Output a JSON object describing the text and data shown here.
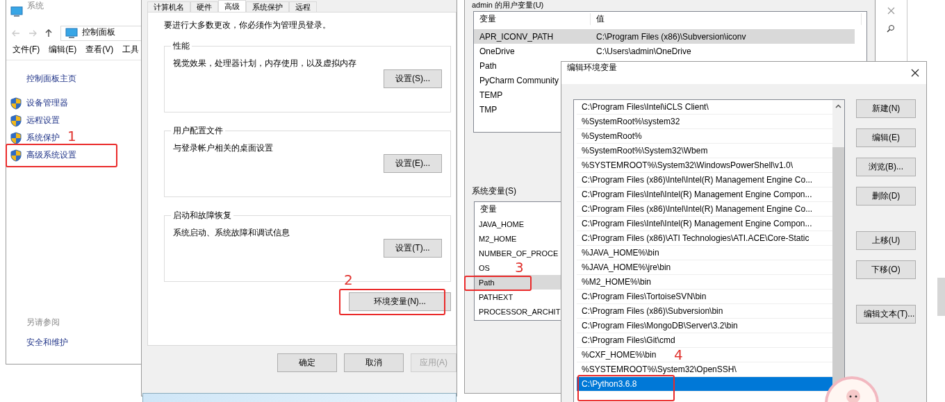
{
  "system_window": {
    "title": "系统",
    "breadcrumb": "控制面板",
    "menu": [
      "文件(F)",
      "编辑(E)",
      "查看(V)",
      "工具"
    ],
    "home_link": "控制面板主页",
    "tasks": [
      "设备管理器",
      "远程设置",
      "系统保护",
      "高级系统设置"
    ],
    "see_also_heading": "另请参阅",
    "see_also": [
      "安全和维护"
    ]
  },
  "properties_dialog": {
    "tabs": [
      {
        "label": "计算机名",
        "selected": false
      },
      {
        "label": "硬件",
        "selected": false
      },
      {
        "label": "高级",
        "selected": true
      },
      {
        "label": "系统保护",
        "selected": false
      },
      {
        "label": "远程",
        "selected": false
      }
    ],
    "notice": "要进行大多数更改，你必须作为管理员登录。",
    "groups": [
      {
        "title": "性能",
        "description": "视觉效果，处理器计划，内存使用，以及虚拟内存",
        "button": "设置(S)..."
      },
      {
        "title": "用户配置文件",
        "description": "与登录帐户相关的桌面设置",
        "button": "设置(E)..."
      },
      {
        "title": "启动和故障恢复",
        "description": "系统启动、系统故障和调试信息",
        "button": "设置(T)..."
      }
    ],
    "env_button": "环境变量(N)...",
    "footer_buttons": [
      {
        "label": "确定",
        "disabled": false
      },
      {
        "label": "取消",
        "disabled": false
      },
      {
        "label": "应用(A)",
        "disabled": true
      }
    ]
  },
  "env_dialog": {
    "user_group": "admin 的用户变量(U)",
    "user_columns": [
      "变量",
      "值"
    ],
    "user_rows": [
      {
        "name": "APR_ICONV_PATH",
        "value": "C:\\Program Files (x86)\\Subversion\\iconv",
        "selected": true
      },
      {
        "name": "OneDrive",
        "value": "C:\\Users\\admin\\OneDrive",
        "selected": false
      },
      {
        "name": "Path",
        "selected": false
      },
      {
        "name": "PyCharm Community",
        "selected": false
      },
      {
        "name": "TEMP",
        "selected": false
      },
      {
        "name": "TMP",
        "selected": false
      }
    ],
    "system_group": "系统变量(S)",
    "system_columns": [
      "变量"
    ],
    "system_rows": [
      {
        "name": "JAVA_HOME",
        "selected": false
      },
      {
        "name": "M2_HOME",
        "selected": false
      },
      {
        "name": "NUMBER_OF_PROCE",
        "selected": false
      },
      {
        "name": "OS",
        "selected": false
      },
      {
        "name": "Path",
        "selected": true
      },
      {
        "name": "PATHEXT",
        "selected": false
      },
      {
        "name": "PROCESSOR_ARCHIT",
        "selected": false
      }
    ]
  },
  "edit_dialog": {
    "title": "编辑环境变量",
    "entries": [
      {
        "text": "C:\\Program Files\\Intel\\iCLS Client\\",
        "selected": false
      },
      {
        "text": "%SystemRoot%\\system32",
        "selected": false
      },
      {
        "text": "%SystemRoot%",
        "selected": false
      },
      {
        "text": "%SystemRoot%\\System32\\Wbem",
        "selected": false
      },
      {
        "text": "%SYSTEMROOT%\\System32\\WindowsPowerShell\\v1.0\\",
        "selected": false
      },
      {
        "text": "C:\\Program Files (x86)\\Intel\\Intel(R) Management Engine Co...",
        "selected": false
      },
      {
        "text": "C:\\Program Files\\Intel\\Intel(R) Management Engine Compon...",
        "selected": false
      },
      {
        "text": "C:\\Program Files (x86)\\Intel\\Intel(R) Management Engine Co...",
        "selected": false
      },
      {
        "text": "C:\\Program Files\\Intel\\Intel(R) Management Engine Compon...",
        "selected": false
      },
      {
        "text": "C:\\Program Files (x86)\\ATI Technologies\\ATI.ACE\\Core-Static",
        "selected": false
      },
      {
        "text": "%JAVA_HOME%\\bin",
        "selected": false
      },
      {
        "text": "%JAVA_HOME%\\jre\\bin",
        "selected": false
      },
      {
        "text": "%M2_HOME%\\bin",
        "selected": false
      },
      {
        "text": "C:\\Program Files\\TortoiseSVN\\bin",
        "selected": false
      },
      {
        "text": "C:\\Program Files (x86)\\Subversion\\bin",
        "selected": false
      },
      {
        "text": "C:\\Program Files\\MongoDB\\Server\\3.2\\bin",
        "selected": false
      },
      {
        "text": "C:\\Program Files\\Git\\cmd",
        "selected": false
      },
      {
        "text": "%CXF_HOME%\\bin",
        "selected": false
      },
      {
        "text": "%SYSTEMROOT%\\System32\\OpenSSH\\",
        "selected": false
      },
      {
        "text": "C:\\Python3.6.8",
        "selected": true
      }
    ],
    "buttons": [
      "新建(N)",
      "编辑(E)",
      "浏览(B)...",
      "删除(D)",
      "上移(U)",
      "下移(O)",
      "编辑文本(T)..."
    ]
  },
  "annotations": [
    "1",
    "2",
    "3",
    "4"
  ]
}
